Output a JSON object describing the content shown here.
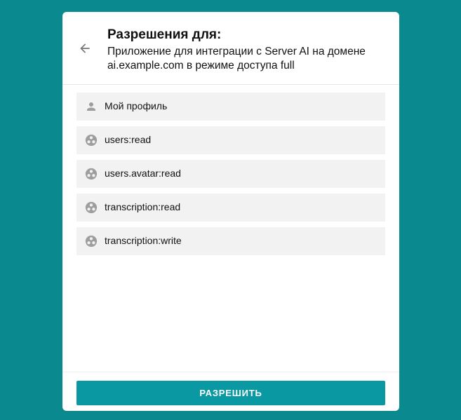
{
  "header": {
    "title": "Разрешения для:",
    "subtitle": "Приложение для интеграции с Server AI на домене ai.example.com в режиме доступа full",
    "back_icon": "arrow-left-icon"
  },
  "permissions": [
    {
      "label": "Мой профиль",
      "icon": "person-icon"
    },
    {
      "label": "users:read",
      "icon": "scope-icon"
    },
    {
      "label": "users.avatar:read",
      "icon": "scope-icon"
    },
    {
      "label": "transcription:read",
      "icon": "scope-icon"
    },
    {
      "label": "transcription:write",
      "icon": "scope-icon"
    }
  ],
  "footer": {
    "allow_label": "РАЗРЕШИТЬ"
  },
  "colors": {
    "background": "#0a8a8e",
    "accent": "#0a98a2",
    "item_bg": "#f2f2f2",
    "icon": "#9e9e9e"
  }
}
